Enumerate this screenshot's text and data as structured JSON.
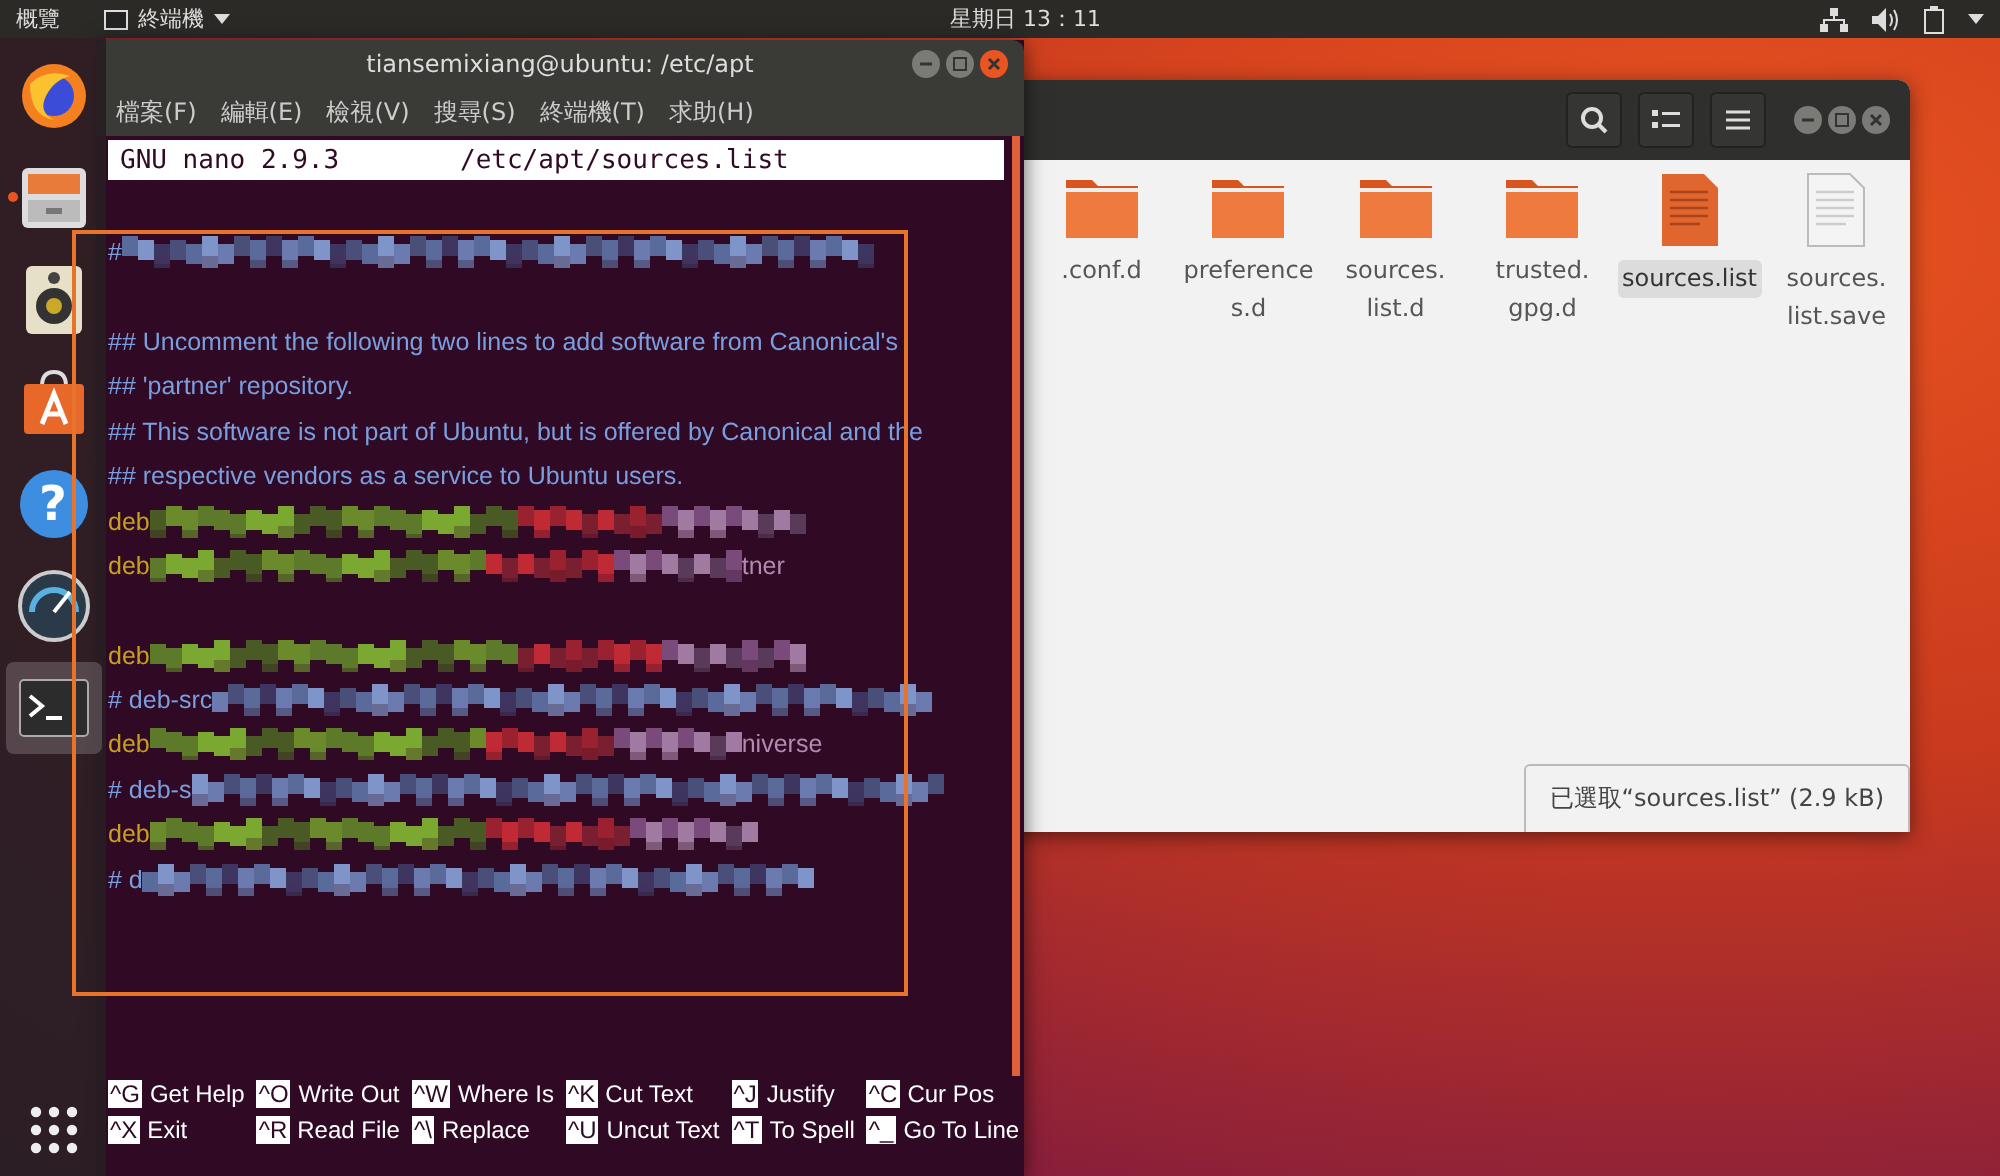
{
  "top_bar": {
    "activities": "概覽",
    "app_menu": "終端機",
    "clock": "星期日 13：11"
  },
  "dock": {
    "items": [
      {
        "kind": "firefox",
        "running": false,
        "selected": false
      },
      {
        "kind": "files",
        "running": true,
        "selected": false
      },
      {
        "kind": "speaker",
        "running": false,
        "selected": false
      },
      {
        "kind": "bag",
        "running": false,
        "selected": false
      },
      {
        "kind": "help",
        "glyph": "?",
        "running": false,
        "selected": false
      },
      {
        "kind": "gauge",
        "running": false,
        "selected": false
      },
      {
        "kind": "terminal",
        "running": false,
        "selected": true
      }
    ]
  },
  "file_manager": {
    "items": [
      {
        "kind": "folder",
        "name": ".conf.d",
        "selected": false
      },
      {
        "kind": "folder",
        "name": "preference s.d",
        "selected": false
      },
      {
        "kind": "folder",
        "name": "sources. list.d",
        "selected": false
      },
      {
        "kind": "folder",
        "name": "trusted. gpg.d",
        "selected": false
      },
      {
        "kind": "text-file",
        "name": "sources.list",
        "selected": true
      },
      {
        "kind": "plain-file",
        "name": "sources. list.save",
        "selected": false
      }
    ],
    "status": "已選取“sources.list” (2.9 kB)"
  },
  "terminal": {
    "title": "tiansemixiang@ubuntu: /etc/apt",
    "menu": [
      "檔案(F)",
      "編輯(E)",
      "檢視(V)",
      "搜尋(S)",
      "終端機(T)",
      "求助(H)"
    ],
    "nano_version": "GNU nano 2.9.3",
    "file_path": "/etc/apt/sources.list",
    "lines": [
      {
        "kind": "comment",
        "text": "#",
        "redacted": true
      },
      {
        "kind": "blank"
      },
      {
        "kind": "comment",
        "text": "## Uncomment the following two lines to add software from Canonical's"
      },
      {
        "kind": "comment",
        "text": "## 'partner' repository."
      },
      {
        "kind": "comment",
        "text": "## This software is not part of Ubuntu, but is offered by Canonical and the"
      },
      {
        "kind": "comment",
        "text": "## respective vendors as a service to Ubuntu users."
      },
      {
        "kind": "source",
        "text": "deb",
        "redacted": true
      },
      {
        "kind": "source",
        "text": "deb",
        "redacted": true,
        "tail": "tner"
      },
      {
        "kind": "blank"
      },
      {
        "kind": "source",
        "text": "deb",
        "redacted": true
      },
      {
        "kind": "comment",
        "text": "# deb-src",
        "redacted": true
      },
      {
        "kind": "source",
        "text": "deb",
        "redacted": true,
        "tail": "niverse"
      },
      {
        "kind": "comment",
        "text": "# deb-s",
        "redacted": true
      },
      {
        "kind": "source",
        "text": "deb",
        "redacted": true
      },
      {
        "kind": "comment",
        "text": "# d",
        "redacted": true
      }
    ],
    "shortcuts": [
      {
        "key": "^G",
        "label": "Get Help"
      },
      {
        "key": "^O",
        "label": "Write Out"
      },
      {
        "key": "^W",
        "label": "Where Is"
      },
      {
        "key": "^K",
        "label": "Cut Text"
      },
      {
        "key": "^J",
        "label": "Justify"
      },
      {
        "key": "^C",
        "label": "Cur Pos"
      },
      {
        "key": "^X",
        "label": "Exit"
      },
      {
        "key": "^R",
        "label": "Read File"
      },
      {
        "key": "^\\",
        "label": "Replace"
      },
      {
        "key": "^U",
        "label": "Uncut Text"
      },
      {
        "key": "^T",
        "label": "To Spell"
      },
      {
        "key": "^_",
        "label": "Go To Line"
      }
    ]
  }
}
